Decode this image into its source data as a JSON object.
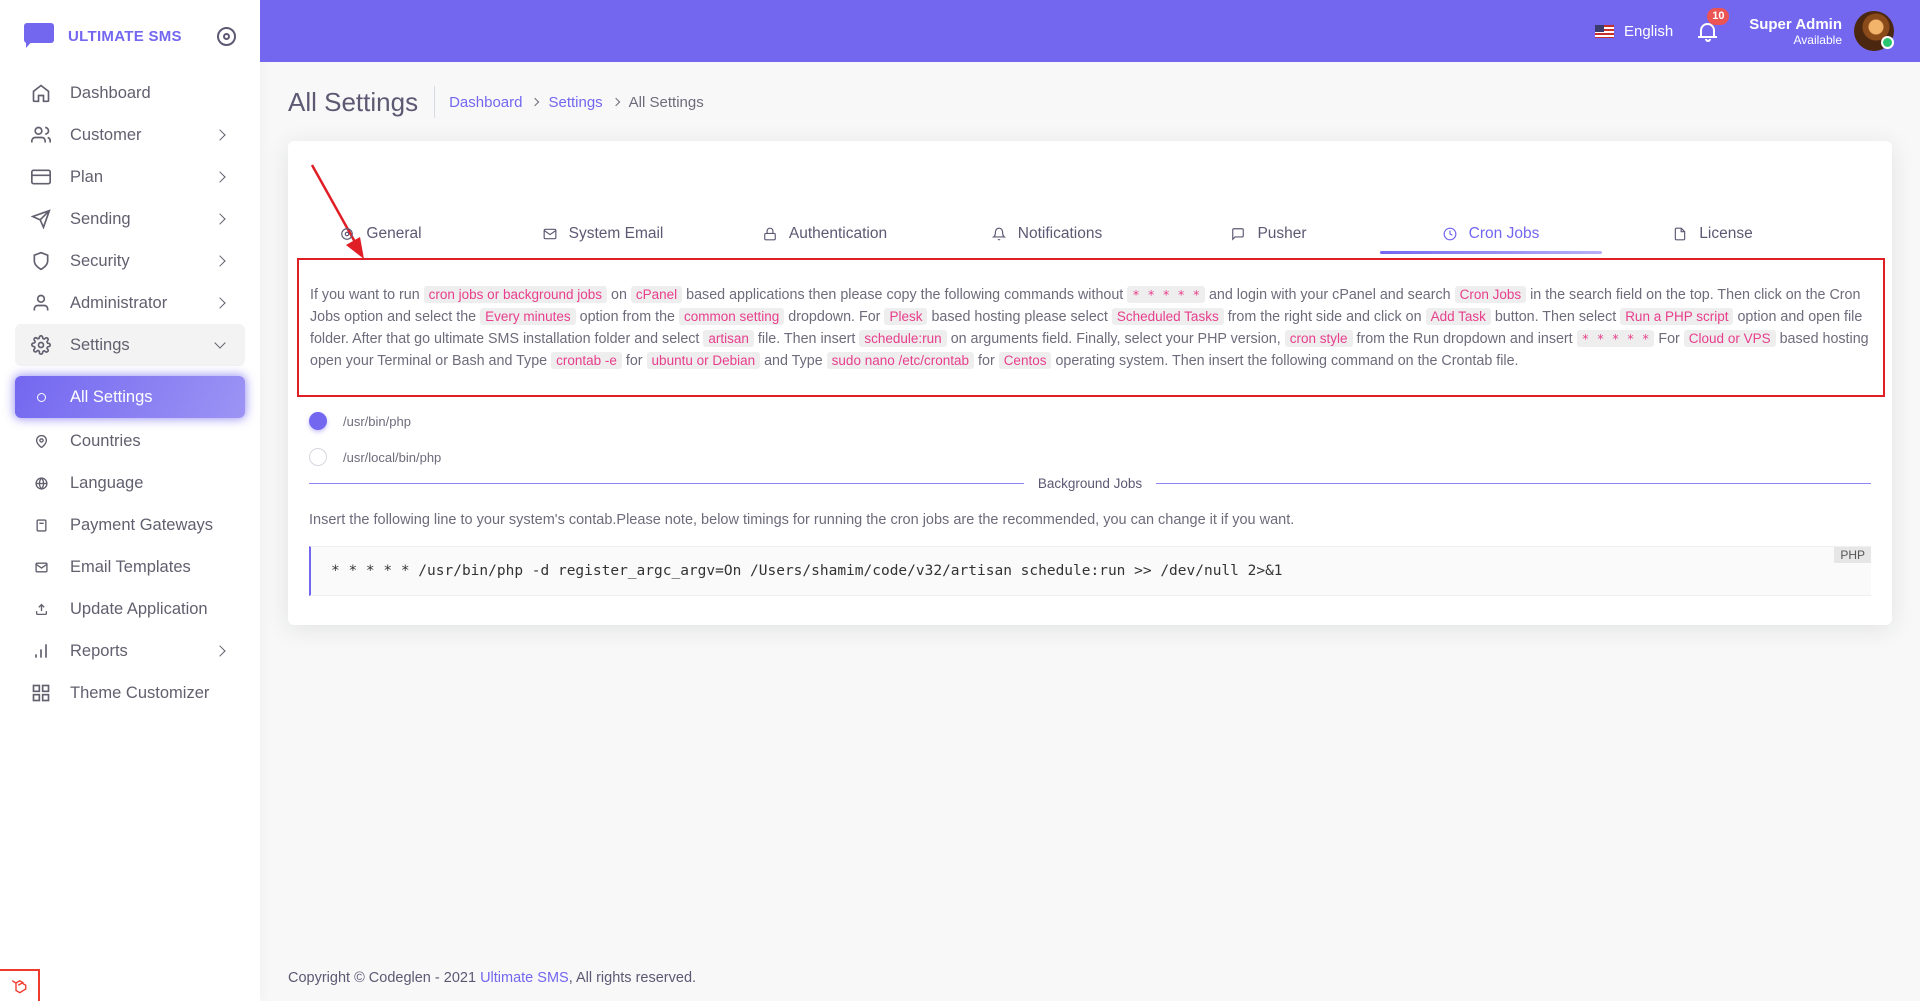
{
  "brand": {
    "name": "ULTIMATE SMS"
  },
  "sidebar": {
    "items": [
      {
        "label": "Dashboard"
      },
      {
        "label": "Customer"
      },
      {
        "label": "Plan"
      },
      {
        "label": "Sending"
      },
      {
        "label": "Security"
      },
      {
        "label": "Administrator"
      },
      {
        "label": "Settings"
      },
      {
        "label": "All Settings"
      },
      {
        "label": "Countries"
      },
      {
        "label": "Language"
      },
      {
        "label": "Payment Gateways"
      },
      {
        "label": "Email Templates"
      },
      {
        "label": "Update Application"
      },
      {
        "label": "Reports"
      },
      {
        "label": "Theme Customizer"
      }
    ]
  },
  "header": {
    "language": "English",
    "notifications_count": "10",
    "user_name": "Super Admin",
    "user_status": "Available",
    "accent_color": "#7367f0"
  },
  "page": {
    "title": "All Settings",
    "breadcrumb": [
      "Dashboard",
      "Settings",
      "All Settings"
    ]
  },
  "tabs": [
    {
      "label": "General",
      "icon": "gear-icon"
    },
    {
      "label": "System Email",
      "icon": "mail-icon"
    },
    {
      "label": "Authentication",
      "icon": "lock-icon"
    },
    {
      "label": "Notifications",
      "icon": "bell-icon"
    },
    {
      "label": "Pusher",
      "icon": "message-icon"
    },
    {
      "label": "Cron Jobs",
      "icon": "clock-icon",
      "active": true
    },
    {
      "label": "License",
      "icon": "file-icon"
    }
  ],
  "notice": {
    "t1": "If you want to run",
    "c1": "cron jobs or background jobs",
    "t2": "on",
    "c2": "cPanel",
    "t3": "based applications then please copy the following commands without",
    "c3": "* * * * *",
    "t4": "and login with your cPanel and search",
    "c4": "Cron Jobs",
    "t5": "in the search field on the top. Then click on the Cron Jobs option and select the",
    "c5": "Every minutes",
    "t6": "option from the",
    "c6": "common setting",
    "t7": "dropdown. For",
    "c7": "Plesk",
    "t8": "based hosting please select",
    "c8": "Scheduled Tasks",
    "t9": "from the right side and click on",
    "c9": "Add Task",
    "t10": "button. Then select",
    "c10": "Run a PHP script",
    "t11": "option and open file folder. After that go ultimate SMS installation folder and select",
    "c11": "artisan",
    "t12": "file. Then insert",
    "c12": "schedule:run",
    "t13": "on arguments field. Finally, select your PHP version,",
    "c13": "cron style",
    "t14": "from the Run dropdown and insert",
    "c14": "* * * * *",
    "t15": "For",
    "c15": "Cloud or VPS",
    "t16": "based hosting open your Terminal or Bash and Type",
    "c16": "crontab -e",
    "t17": "for",
    "c17": "ubuntu or Debian",
    "t18": "and Type",
    "c18": "sudo nano /etc/crontab",
    "t19": "for",
    "c19": "Centos",
    "t20": "operating system. Then insert the following command on the Crontab file."
  },
  "php_paths": [
    {
      "label": "/usr/bin/php",
      "checked": true
    },
    {
      "label": "/usr/local/bin/php",
      "checked": false
    }
  ],
  "background_jobs": {
    "title": "Background Jobs",
    "instruction": "Insert the following line to your system's contab.Please note, below timings for running the cron jobs are the recommended, you can change it if you want.",
    "code_lang": "PHP",
    "code": "* * * * * /usr/bin/php -d register_argc_argv=On /Users/shamim/code/v32/artisan schedule:run >> /dev/null 2>&1"
  },
  "footer": {
    "prefix": "Copyright © Codeglen - 2021",
    "link": "Ultimate SMS",
    "suffix": ", All rights reserved."
  }
}
